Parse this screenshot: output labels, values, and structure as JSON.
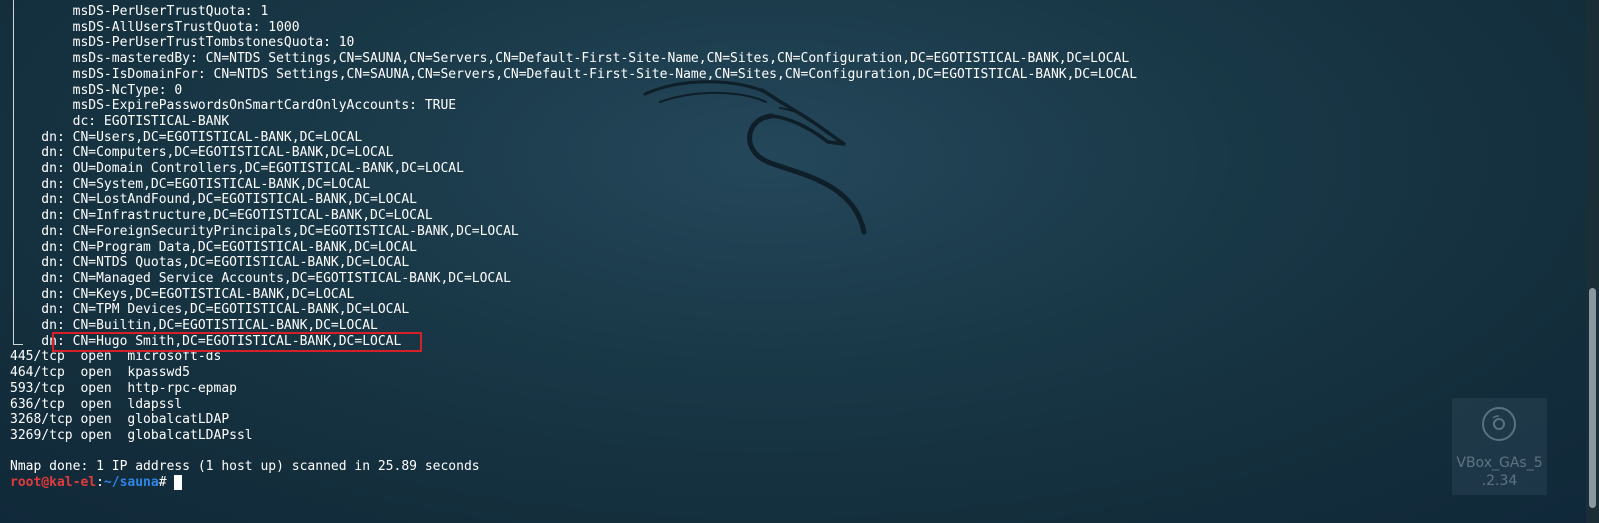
{
  "terminal": {
    "lines": [
      "        msDS-PerUserTrustQuota: 1",
      "        msDS-AllUsersTrustQuota: 1000",
      "        msDS-PerUserTrustTombstonesQuota: 10",
      "        msDs-masteredBy: CN=NTDS Settings,CN=SAUNA,CN=Servers,CN=Default-First-Site-Name,CN=Sites,CN=Configuration,DC=EGOTISTICAL-BANK,DC=LOCAL",
      "        msDS-IsDomainFor: CN=NTDS Settings,CN=SAUNA,CN=Servers,CN=Default-First-Site-Name,CN=Sites,CN=Configuration,DC=EGOTISTICAL-BANK,DC=LOCAL",
      "        msDS-NcType: 0",
      "        msDS-ExpirePasswordsOnSmartCardOnlyAccounts: TRUE",
      "        dc: EGOTISTICAL-BANK",
      "    dn: CN=Users,DC=EGOTISTICAL-BANK,DC=LOCAL",
      "    dn: CN=Computers,DC=EGOTISTICAL-BANK,DC=LOCAL",
      "    dn: OU=Domain Controllers,DC=EGOTISTICAL-BANK,DC=LOCAL",
      "    dn: CN=System,DC=EGOTISTICAL-BANK,DC=LOCAL",
      "    dn: CN=LostAndFound,DC=EGOTISTICAL-BANK,DC=LOCAL",
      "    dn: CN=Infrastructure,DC=EGOTISTICAL-BANK,DC=LOCAL",
      "    dn: CN=ForeignSecurityPrincipals,DC=EGOTISTICAL-BANK,DC=LOCAL",
      "    dn: CN=Program Data,DC=EGOTISTICAL-BANK,DC=LOCAL",
      "    dn: CN=NTDS Quotas,DC=EGOTISTICAL-BANK,DC=LOCAL",
      "    dn: CN=Managed Service Accounts,DC=EGOTISTICAL-BANK,DC=LOCAL",
      "    dn: CN=Keys,DC=EGOTISTICAL-BANK,DC=LOCAL",
      "    dn: CN=TPM Devices,DC=EGOTISTICAL-BANK,DC=LOCAL",
      "    dn: CN=Builtin,DC=EGOTISTICAL-BANK,DC=LOCAL",
      "    dn: CN=Hugo Smith,DC=EGOTISTICAL-BANK,DC=LOCAL",
      "445/tcp  open  microsoft-ds",
      "464/tcp  open  kpasswd5",
      "593/tcp  open  http-rpc-epmap",
      "636/tcp  open  ldapssl",
      "3268/tcp open  globalcatLDAP",
      "3269/tcp open  globalcatLDAPssl",
      "",
      "Nmap done: 1 IP address (1 host up) scanned in 25.89 seconds"
    ],
    "prompt": {
      "user_host": "root@kal-el",
      "separator": ":",
      "path": "~/sauna",
      "symbol": "# "
    }
  },
  "desktop": {
    "icon_label": "VBox_GAs_5\n.2.34",
    "icon_name": "cd-disc-icon"
  },
  "colors": {
    "prompt_user": "#e23a3a",
    "prompt_path": "#2f86e6",
    "highlight_border": "#d61f26"
  }
}
